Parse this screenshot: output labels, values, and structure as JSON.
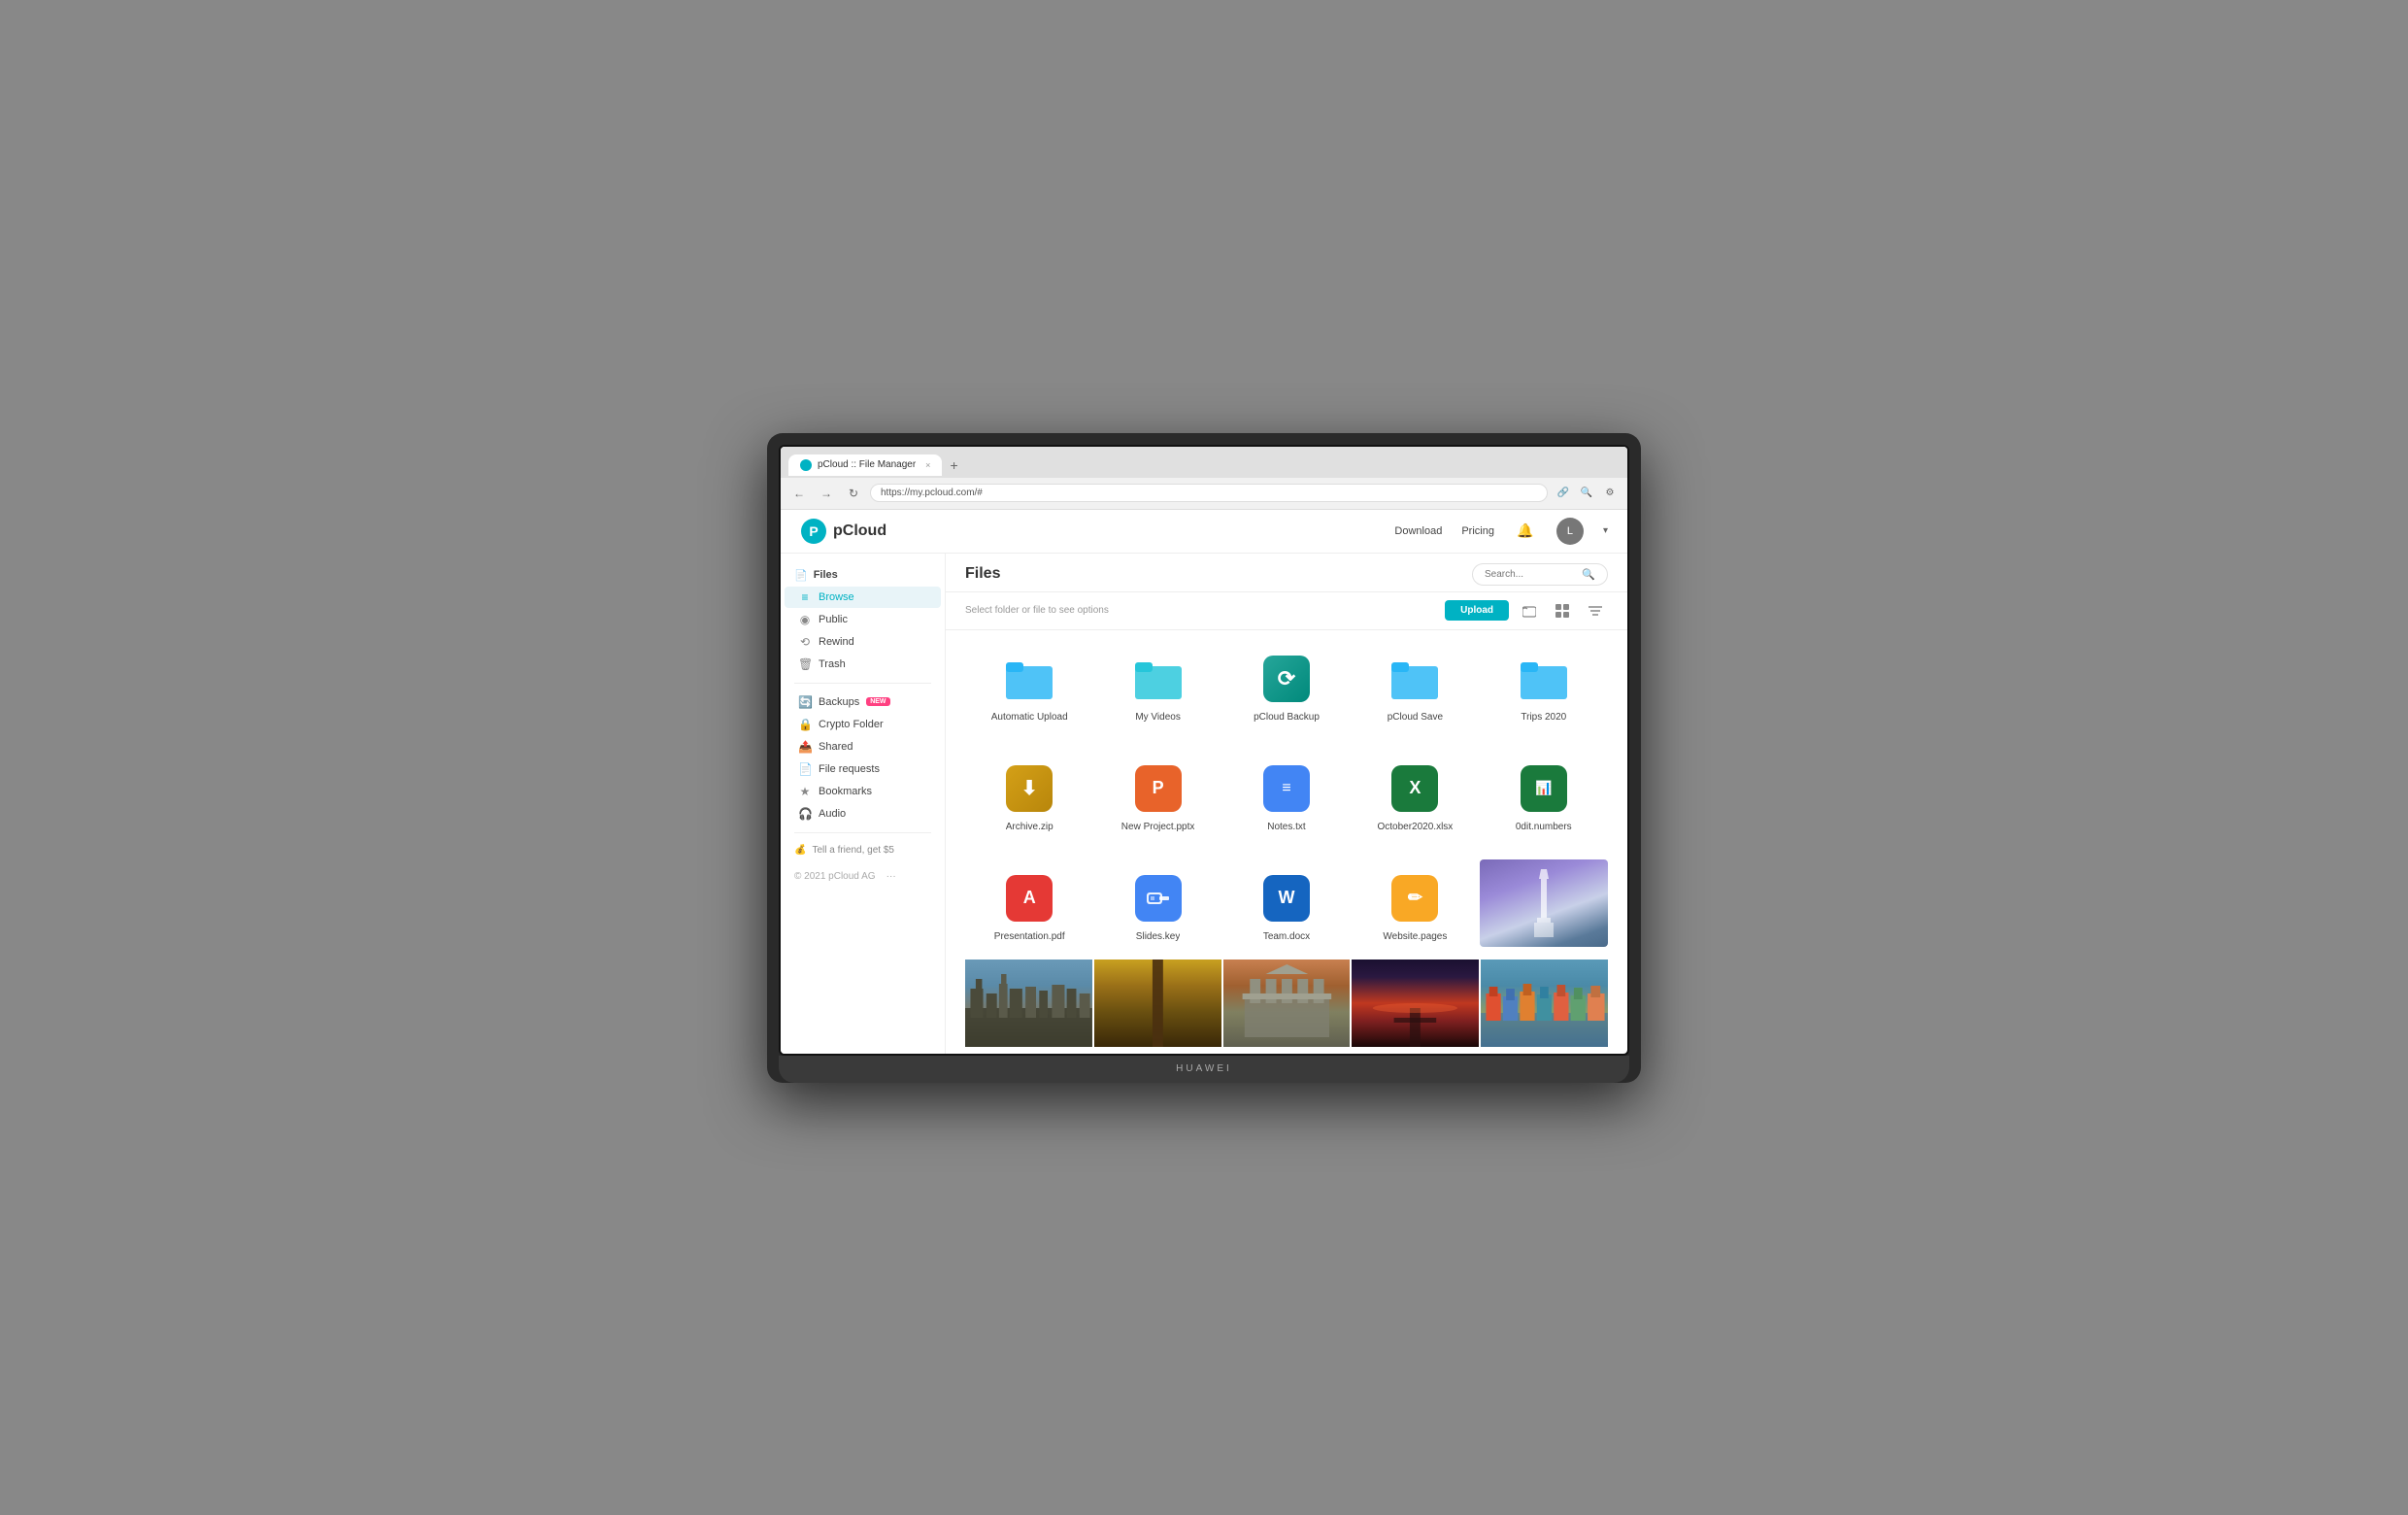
{
  "browser": {
    "tab_title": "pCloud :: File Manager",
    "tab_close": "×",
    "tab_new": "+",
    "url": "https://my.pcloud.com/#",
    "nav_back": "←",
    "nav_forward": "→",
    "nav_refresh": "↻"
  },
  "topnav": {
    "logo_text": "pCloud",
    "link_download": "Download",
    "link_pricing": "Pricing",
    "avatar_initial": "L"
  },
  "sidebar": {
    "files_label": "Files",
    "items": [
      {
        "id": "browse",
        "label": "Browse",
        "icon": "≡"
      },
      {
        "id": "public",
        "label": "Public",
        "icon": "⊕"
      },
      {
        "id": "rewind",
        "label": "Rewind",
        "icon": "↩"
      },
      {
        "id": "trash",
        "label": "Trash",
        "icon": "🗑"
      }
    ],
    "extras": [
      {
        "id": "backups",
        "label": "Backups",
        "badge": "NEW"
      },
      {
        "id": "crypto",
        "label": "Crypto Folder"
      },
      {
        "id": "shared",
        "label": "Shared"
      },
      {
        "id": "file-requests",
        "label": "File requests"
      },
      {
        "id": "bookmarks",
        "label": "Bookmarks"
      },
      {
        "id": "audio",
        "label": "Audio"
      }
    ],
    "tell_friend": "Tell a friend, get $5",
    "copyright": "© 2021 pCloud AG"
  },
  "filearea": {
    "title": "Files",
    "search_placeholder": "Search...",
    "toolbar_info": "Select folder or file to see options",
    "upload_label": "Upload",
    "folders": [
      {
        "name": "Automatic Upload",
        "type": "folder",
        "color": "blue"
      },
      {
        "name": "My Videos",
        "type": "folder",
        "color": "blue"
      },
      {
        "name": "pCloud Backup",
        "type": "special"
      },
      {
        "name": "pCloud Save",
        "type": "folder",
        "color": "blue"
      },
      {
        "name": "Trips 2020",
        "type": "folder",
        "color": "blue"
      }
    ],
    "files": [
      {
        "name": "Archive.zip",
        "type": "archive"
      },
      {
        "name": "New Project.pptx",
        "type": "pptx"
      },
      {
        "name": "Notes.txt",
        "type": "txt"
      },
      {
        "name": "October2020.xlsx",
        "type": "xlsx"
      },
      {
        "name": "0dit.numbers",
        "type": "numbers"
      }
    ],
    "files2": [
      {
        "name": "Presentation.pdf",
        "type": "pdf"
      },
      {
        "name": "Slides.key",
        "type": "key"
      },
      {
        "name": "Team.docx",
        "type": "word"
      },
      {
        "name": "Website.pages",
        "type": "website"
      },
      {
        "name": "photo_purple",
        "type": "photo_purple"
      }
    ],
    "photos": [
      {
        "name": "amsterdam",
        "label": "Amsterdam photo"
      },
      {
        "name": "forest",
        "label": "Forest photo"
      },
      {
        "name": "gate",
        "label": "Gate photo"
      },
      {
        "name": "sunset",
        "label": "Sunset photo"
      },
      {
        "name": "harbor",
        "label": "Harbor photo"
      }
    ]
  },
  "icons": {
    "search": "🔍",
    "upload_cloud": "☁",
    "new_folder": "📁",
    "grid": "⊞",
    "filter": "≡",
    "browse": "≡",
    "public": "◉",
    "rewind": "⟲",
    "trash": "🗑",
    "backups": "🔄",
    "crypto": "🔒",
    "shared": "📤",
    "file_requests": "📄",
    "bookmarks": "★",
    "audio": "🎧",
    "tell_friend": "💰",
    "files": "📄",
    "bell": "🔔",
    "dots": "···"
  }
}
